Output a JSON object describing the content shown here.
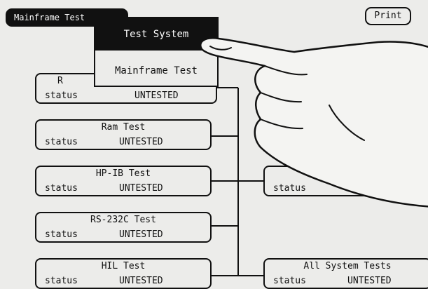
{
  "header": {
    "mode_field_label": "Mainframe Test",
    "print_button_label": "Print"
  },
  "menu": {
    "items": [
      {
        "label": "Test System",
        "selected": true
      },
      {
        "label": "Mainframe Test",
        "selected": false
      }
    ]
  },
  "tests": [
    {
      "name": "R",
      "status_label": "status",
      "status_value": "UNTESTED"
    },
    {
      "name": "Ram Test",
      "status_label": "status",
      "status_value": "UNTESTED"
    },
    {
      "name": "HP-IB Test",
      "status_label": "status",
      "status_value": "UNTESTED"
    },
    {
      "name": "RS-232C Test",
      "status_label": "status",
      "status_value": "UNTESTED"
    },
    {
      "name": "HIL Test",
      "status_label": "status",
      "status_value": "UNTESTED"
    }
  ],
  "right_tests": [
    {
      "name": "",
      "status_label": "status",
      "status_value": ""
    },
    {
      "name": "All System Tests",
      "status_label": "status",
      "status_value": "UNTESTED"
    }
  ],
  "colors": {
    "ink": "#111111",
    "background": "#ececea"
  }
}
